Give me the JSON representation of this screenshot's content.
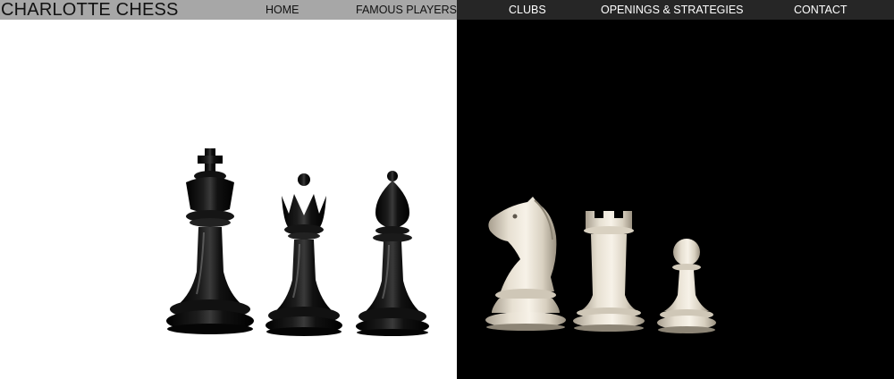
{
  "brand": {
    "title": "CHARLOTTE CHESS"
  },
  "nav": {
    "items": [
      {
        "label": "HOME"
      },
      {
        "label": "FAMOUS PLAYERS"
      },
      {
        "label": "CLUBS"
      },
      {
        "label": "OPENINGS & STRATEGIES"
      },
      {
        "label": "CONTACT"
      }
    ]
  },
  "hero": {
    "left_pieces": [
      "king",
      "queen",
      "bishop"
    ],
    "right_pieces": [
      "knight",
      "rook",
      "pawn"
    ]
  },
  "colors": {
    "nav_left_bg": "#a7a7a7",
    "nav_right_bg": "#262626",
    "black_piece": "#0a0a0a",
    "white_piece": "#e7e0d2"
  }
}
